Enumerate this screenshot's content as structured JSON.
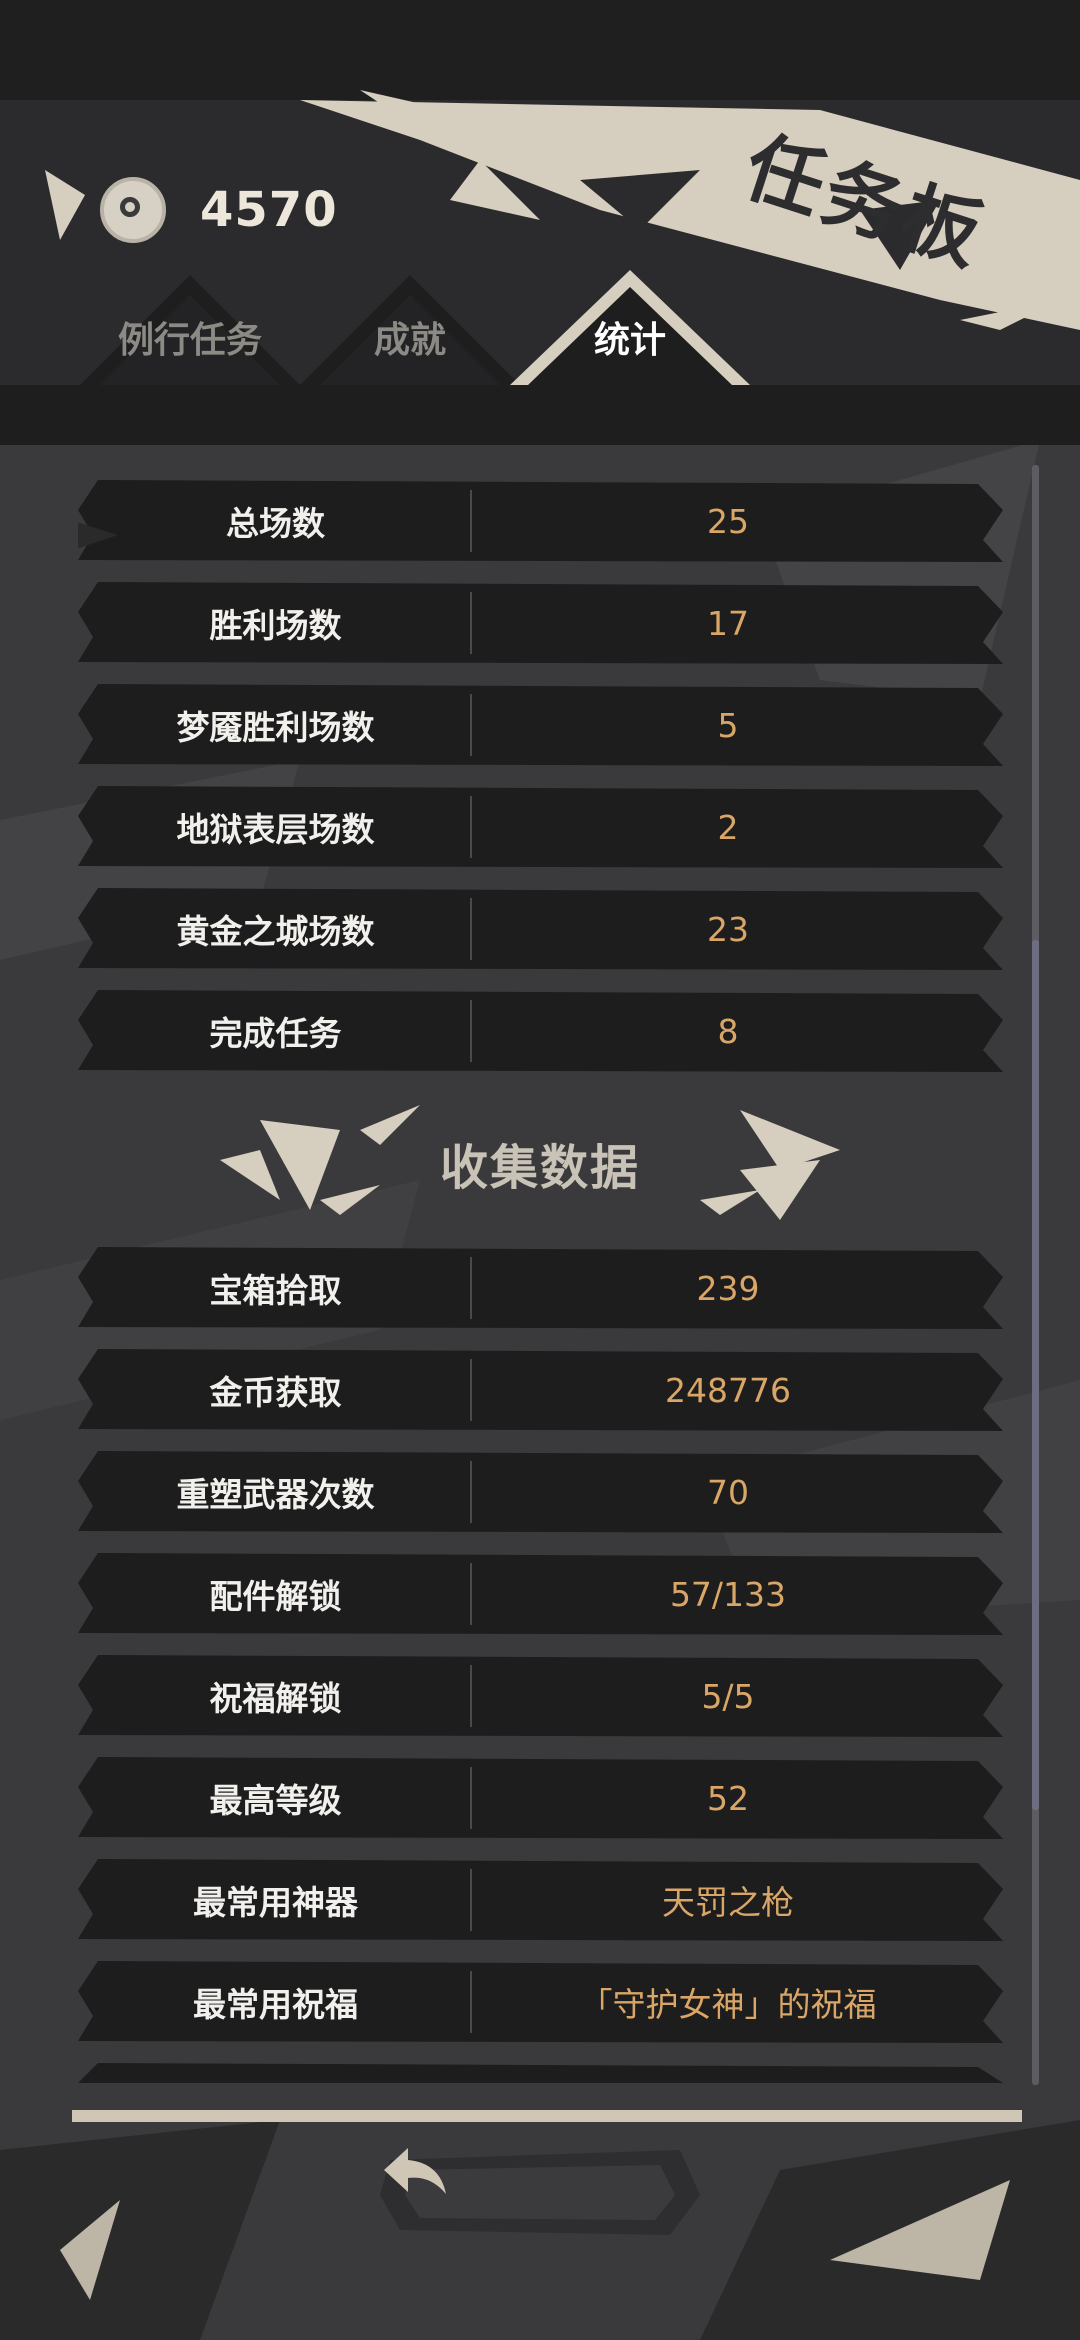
{
  "header": {
    "title": "任务板",
    "currency": {
      "icon": "coin-icon",
      "value": "4570"
    }
  },
  "tabs": [
    {
      "label": "例行任务",
      "active": false
    },
    {
      "label": "成就",
      "active": false
    },
    {
      "label": "统计",
      "active": true
    }
  ],
  "stats": [
    {
      "label": "总场数",
      "value": "25"
    },
    {
      "label": "胜利场数",
      "value": "17"
    },
    {
      "label": "梦魇胜利场数",
      "value": "5"
    },
    {
      "label": "地狱表层场数",
      "value": "2"
    },
    {
      "label": "黄金之城场数",
      "value": "23"
    },
    {
      "label": "完成任务",
      "value": "8"
    }
  ],
  "collection": {
    "title": "收集数据",
    "rows": [
      {
        "label": "宝箱拾取",
        "value": "239"
      },
      {
        "label": "金币获取",
        "value": "248776"
      },
      {
        "label": "重塑武器次数",
        "value": "70"
      },
      {
        "label": "配件解锁",
        "value": "57/133"
      },
      {
        "label": "祝福解锁",
        "value": "5/5"
      },
      {
        "label": "最高等级",
        "value": "52"
      },
      {
        "label": "最常用神器",
        "value": "天罚之枪"
      },
      {
        "label": "最常用祝福",
        "value": "「守护女神」的祝福"
      }
    ]
  },
  "footer": {
    "back_icon": "back-arrow-icon"
  },
  "colors": {
    "background": "#3a3a3c",
    "row": "#1d1d1e",
    "label": "#f2f0ec",
    "value": "#d9a667",
    "accent": "#d6cebf"
  }
}
